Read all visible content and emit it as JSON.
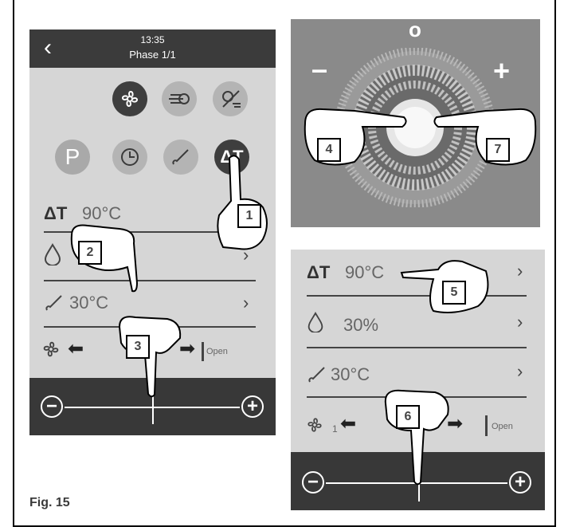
{
  "left_phone": {
    "time": "13:35",
    "phase": "Phase 1/1",
    "delta_t_value": "90°C",
    "core_temp_value": "30°C",
    "p_label": "P",
    "open_label": "Open"
  },
  "knob_panel": {
    "top_symbol": "o",
    "minus_symbol": "–",
    "plus_symbol": "+"
  },
  "right_phone": {
    "delta_t_value": "90°C",
    "humidity_value": "30%",
    "core_temp_value": "30°C",
    "fan_level": "1",
    "open_label": "Open"
  },
  "callouts": [
    "1",
    "2",
    "3",
    "4",
    "5",
    "6",
    "7"
  ],
  "figure_label": "Fig. 15",
  "colors": {
    "panel": "#d6d6d6",
    "bar": "#383838",
    "dark_button": "#3e3e3e"
  }
}
